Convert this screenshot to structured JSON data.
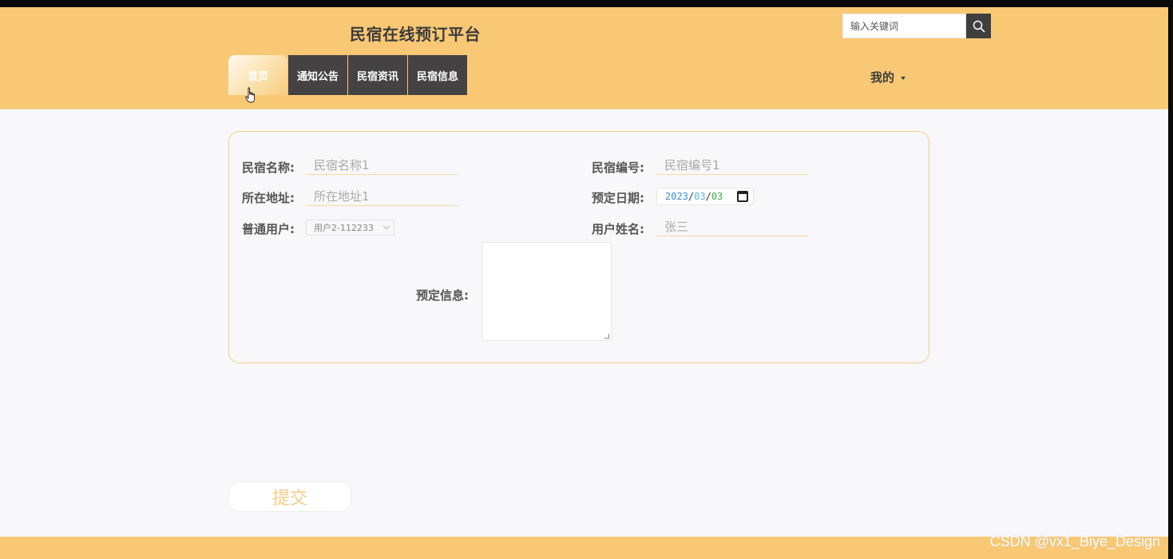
{
  "header": {
    "site_title": "民宿在线预订平台",
    "search_placeholder": "输入关键词",
    "mine_label": "我的"
  },
  "nav": {
    "items": [
      {
        "label": "首页"
      },
      {
        "label": "通知公告"
      },
      {
        "label": "民宿资讯"
      },
      {
        "label": "民宿信息"
      }
    ],
    "active_index": 0
  },
  "form": {
    "homestay_name_label": "民宿名称:",
    "homestay_name_value": "民宿名称1",
    "homestay_no_label": "民宿编号:",
    "homestay_no_value": "民宿编号1",
    "address_label": "所在地址:",
    "address_value": "所在地址1",
    "booking_date_label": "预定日期:",
    "booking_date": {
      "year": "2023",
      "month": "03",
      "day": "03"
    },
    "user_label": "普通用户:",
    "user_value": "用户2-112233",
    "user_name_label": "用户姓名:",
    "user_name_value": "张三",
    "booking_info_label": "预定信息:",
    "booking_info_value": ""
  },
  "submit_label": "提交",
  "watermark": "CSDN @vx1_Biye_Design",
  "colors": {
    "header_bg": "#f9c874",
    "nav_bg": "#444242",
    "search_btn": "#3f3f3f",
    "card_border": "#f3cd8c",
    "submit_text": "#f6cc82"
  }
}
